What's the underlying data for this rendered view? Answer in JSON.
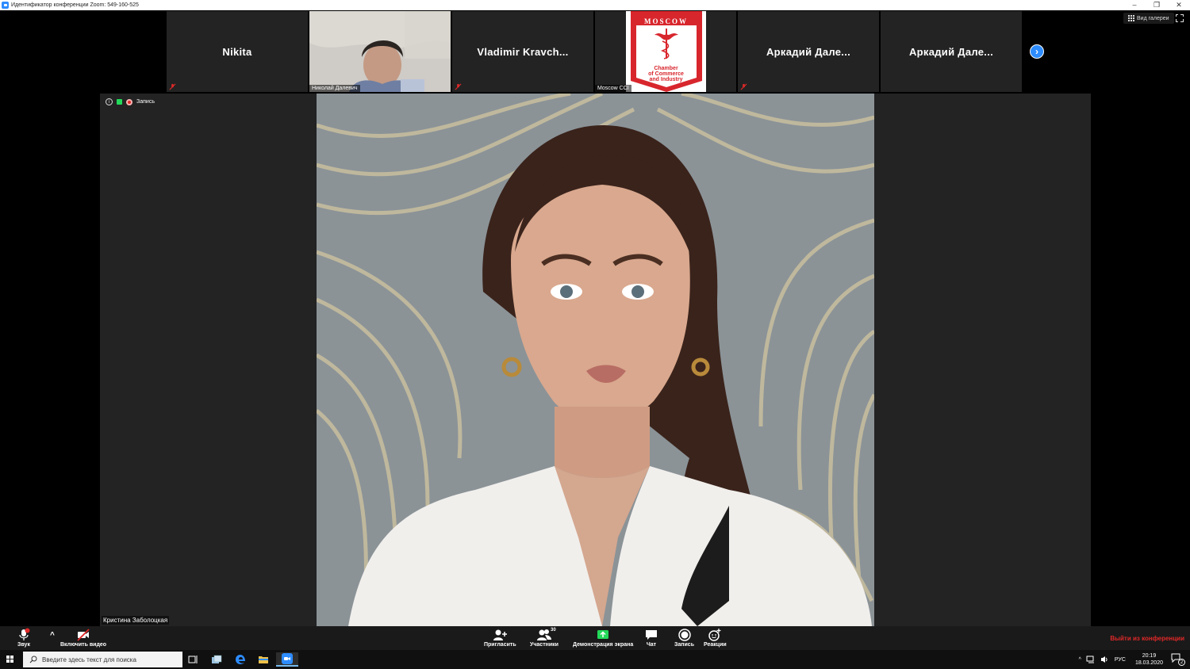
{
  "window": {
    "title": "Идентификатор конференции Zoom: 549-160-525",
    "controls": [
      "–",
      "❐",
      "✕"
    ]
  },
  "top_right": {
    "gallery_view_label": "Вид галереи"
  },
  "participants_strip": [
    {
      "name": "Nikita",
      "type": "name",
      "muted": true
    },
    {
      "name": "Николай Далевич",
      "type": "video",
      "muted": false
    },
    {
      "name": "Vladimir  Kravch...",
      "type": "name",
      "muted": true
    },
    {
      "name": "Moscow CCI",
      "type": "logo",
      "muted": false
    },
    {
      "name": "Аркадий  Дале...",
      "type": "name",
      "muted": true
    },
    {
      "name": "Аркадий  Дале...",
      "type": "name",
      "muted": false
    }
  ],
  "cci_logo": {
    "top_text": "MOSCOW",
    "lines": [
      "Chamber",
      "of Commerce",
      "and Industry"
    ],
    "color": "#d8262d"
  },
  "main_video": {
    "recording_label": "Запись",
    "speaker_name": "Кристина Заболоцкая"
  },
  "toolbar": {
    "audio_label": "Звук",
    "video_label": "Включить видео",
    "invite_label": "Пригласить",
    "participants_label": "Участники",
    "participants_count": "30",
    "share_label": "Демонстрация экрана",
    "chat_label": "Чат",
    "record_label": "Запись",
    "reactions_label": "Реакции",
    "leave_label": "Выйти из конференции"
  },
  "taskbar": {
    "search_placeholder": "Введите здесь текст для поиска",
    "language": "РУС",
    "time": "20:19",
    "date": "18.03.2020",
    "notification_count": "2"
  },
  "colors": {
    "zoom_blue": "#2d8cff",
    "leave_red": "#e02828",
    "share_green": "#23d959",
    "tile_bg": "#232323"
  }
}
